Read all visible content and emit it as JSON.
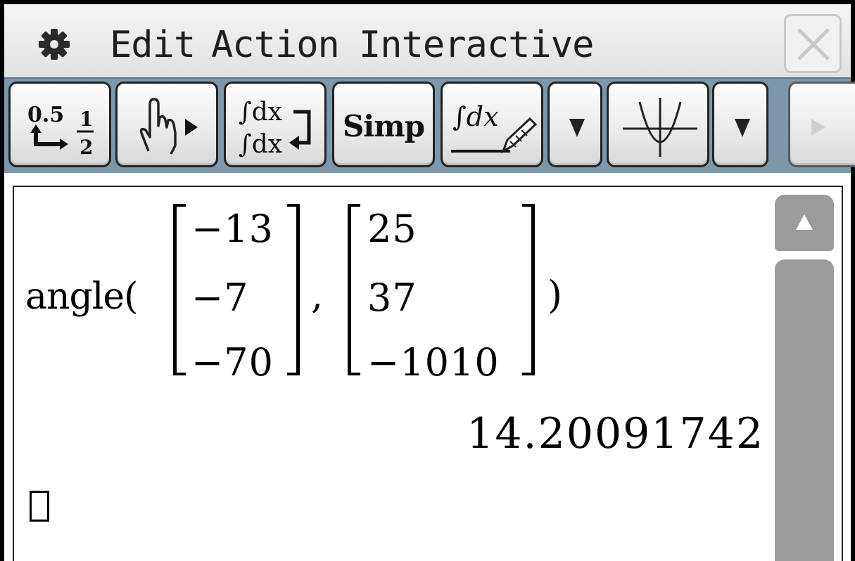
{
  "menu": {
    "settings_icon": "gear-icon",
    "items": [
      "Edit",
      "Action",
      "Interactive"
    ],
    "close_icon": "close-icon"
  },
  "toolbar": {
    "buttons": [
      {
        "name": "decimal-fraction-toggle",
        "icon": "decimal-fraction-icon",
        "decimal_label": "0.5",
        "fraction_num": "1",
        "fraction_den": "2"
      },
      {
        "name": "drag-hand",
        "icon": "hand-pointer-icon"
      },
      {
        "name": "integral-toggle",
        "icon": "integral-swap-icon",
        "label": "∫dx"
      },
      {
        "name": "simplify",
        "label": "Simp"
      },
      {
        "name": "math-input",
        "icon": "integral-pencil-icon",
        "label": "∫dx"
      },
      {
        "name": "dropdown-1",
        "icon": "triangle-down-icon"
      },
      {
        "name": "graph",
        "icon": "graph-parabola-icon"
      },
      {
        "name": "dropdown-2",
        "icon": "triangle-down-icon"
      },
      {
        "name": "scroll-right",
        "icon": "triangle-right-icon"
      }
    ],
    "colors": {
      "bar": "#7d98ab"
    }
  },
  "work": {
    "function_name": "angle(",
    "closing_paren": ")",
    "separator": ",",
    "vector_a": [
      "−13",
      "−7",
      "−70"
    ],
    "vector_b": [
      "25",
      "37",
      "−1010"
    ],
    "result": "14.20091742"
  },
  "scrollbar": {
    "up_icon": "triangle-up-icon"
  }
}
